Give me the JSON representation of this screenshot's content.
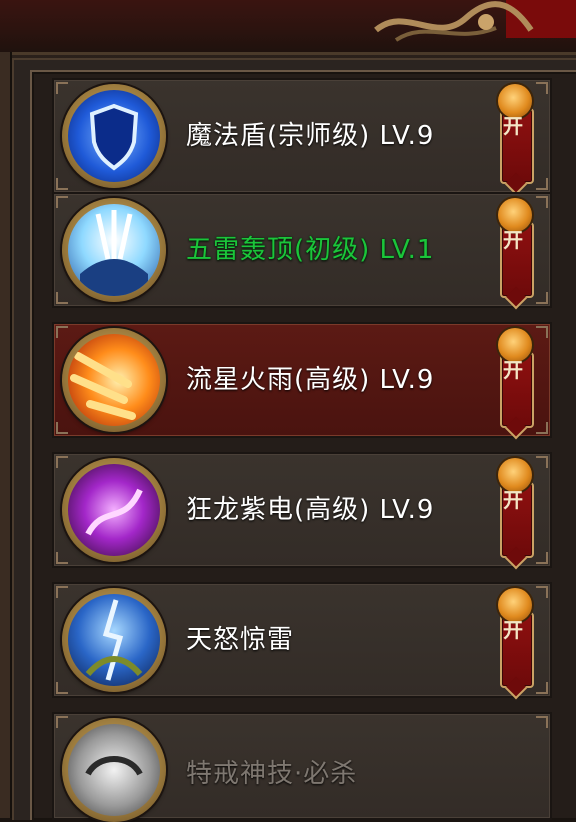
{
  "skills": [
    {
      "name": "魔法盾(宗师级) LV.9",
      "name_color": "white",
      "toggle": "开",
      "icon": "magic-shield-icon"
    },
    {
      "name": "五雷轰顶(初级) LV.1",
      "name_color": "green",
      "toggle": "开",
      "icon": "five-thunder-icon"
    },
    {
      "name": "流星火雨(高级) LV.9",
      "name_color": "white",
      "toggle": "开",
      "icon": "meteor-rain-icon",
      "selected": true
    },
    {
      "name": "狂龙紫电(高级) LV.9",
      "name_color": "white",
      "toggle": "开",
      "icon": "purple-dragon-lightning-icon"
    },
    {
      "name": "天怒惊雷",
      "name_color": "white",
      "toggle": "开",
      "icon": "heaven-thunder-icon"
    },
    {
      "name": "特戒神技·必杀",
      "name_color": "grey",
      "icon": "ring-skill-icon"
    }
  ],
  "colors": {
    "active_row": "#4a130f",
    "green_name": "#1bc53a",
    "grey_name": "#7e7770"
  }
}
